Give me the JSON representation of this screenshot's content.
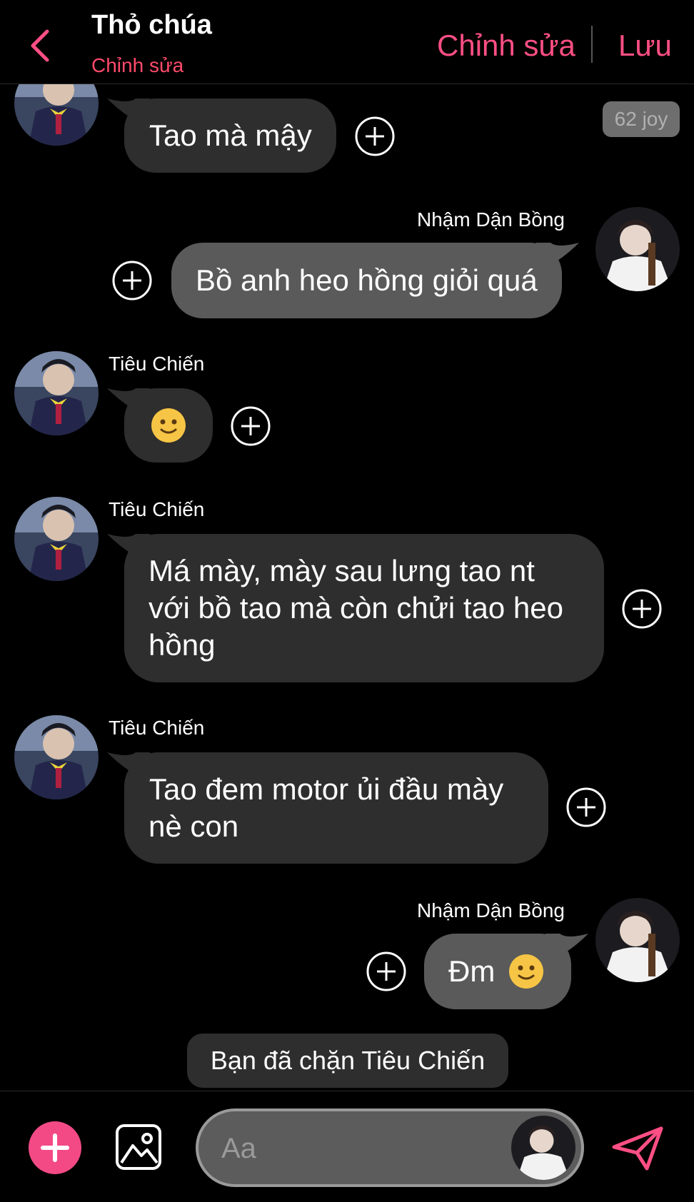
{
  "header": {
    "title": "Thỏ chúa",
    "subtitle": "Chỉnh sửa",
    "edit_label": "Chỉnh sửa",
    "save_label": "Lưu"
  },
  "badge": {
    "joy": "62 joy"
  },
  "messages": [
    {
      "sender": "",
      "text": "Tao mà mậy"
    },
    {
      "sender": "Nhậm Dận Bồng",
      "text": "Bồ anh heo hồng giỏi quá"
    },
    {
      "sender": "Tiêu Chiến",
      "text": ""
    },
    {
      "sender": "Tiêu Chiến",
      "text": "Má mày, mày sau lưng tao nt\nvới bồ tao mà còn chửi tao heo\nhồng"
    },
    {
      "sender": "Tiêu Chiến",
      "text": "Tao đem motor ủi đầu mày\nnè con"
    },
    {
      "sender": "Nhậm Dận Bồng",
      "text": "Đm"
    }
  ],
  "notice": "Bạn đã chặn Tiêu Chiến",
  "composer": {
    "placeholder": "Aa"
  },
  "colors": {
    "accent": "#ff4f84",
    "subtitle": "#ff4a6a",
    "bubble_left": "#2e2e2e",
    "bubble_right": "#5a5a5a",
    "add_button": "#f34a86"
  }
}
